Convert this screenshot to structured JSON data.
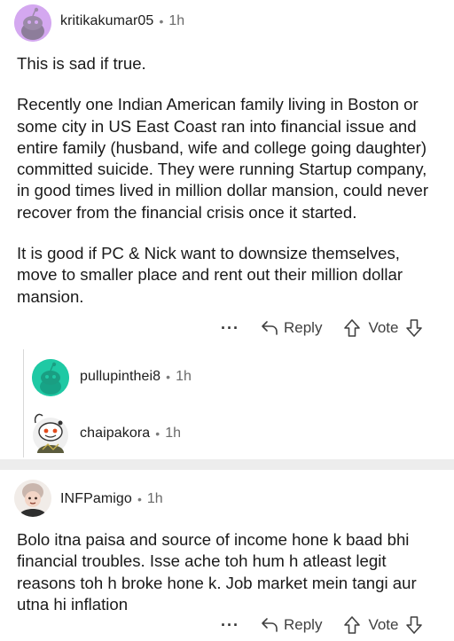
{
  "comments": [
    {
      "username": "kritikakumar05",
      "time": "1h",
      "paragraphs": [
        "This is sad if true.",
        "Recently one Indian American family living in Boston or some city in US East Coast ran into financial issue and entire family (husband, wife and college going daughter) committed suicide. They were running Startup company, in good times lived in million dollar mansion, could never recover from the financial crisis once it started.",
        "It is good if PC & Nick want to downsize themselves, move to smaller place and rent out their million dollar mansion."
      ],
      "actions": {
        "more": "···",
        "reply": "Reply",
        "vote": "Vote"
      }
    },
    {
      "username": "INFPamigo",
      "time": "1h",
      "paragraphs": [
        "Bolo itna paisa and source of income hone k baad bhi financial troubles. Isse ache toh hum h atleast legit reasons toh h broke hone k. Job market mein tangi aur utna hi inflation"
      ],
      "actions": {
        "more": "···",
        "reply": "Reply",
        "vote": "Vote"
      }
    }
  ],
  "replies": [
    {
      "username": "pullupinthei8",
      "time": "1h"
    },
    {
      "username": "chaipakora",
      "time": "1h"
    }
  ],
  "separator": "•",
  "colors": {
    "avatar_purple": "#d4a8f0",
    "avatar_teal": "#1fc9a4",
    "thread_line": "#d8d8d8",
    "separator_bg": "#ededed"
  }
}
